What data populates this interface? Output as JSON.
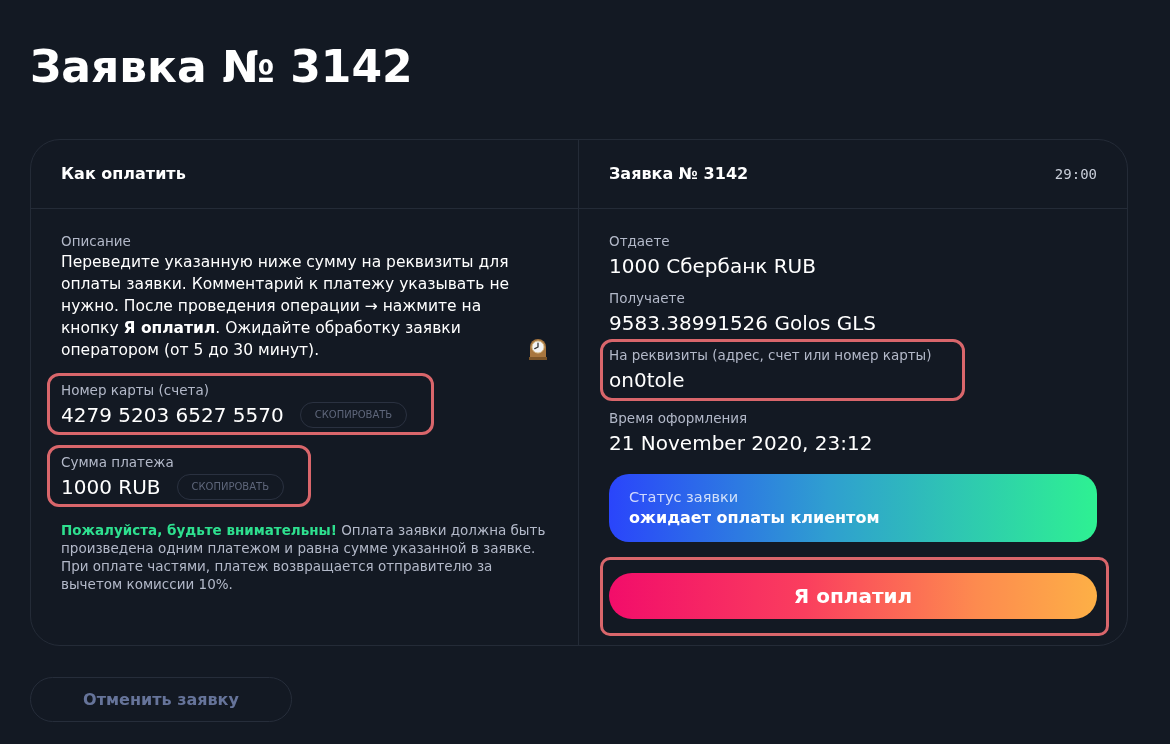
{
  "page": {
    "title": "Заявка № 3142"
  },
  "left_panel": {
    "title": "Как оплатить",
    "description": {
      "label": "Описание",
      "text": "Переведите указанную ниже сумму на реквизиты для оплаты заявки. Комментарий к платежу указывать не нужно. После проведения операции → нажмите на кнопку **Я оплатил**. Ожидайте обработку заявки оператором (от 5 до 30 минут)."
    },
    "fields": [
      {
        "label": "Номер карты (счета)",
        "value": "4279 5203 6527 5570",
        "copy_label": "СКОПИРОВАТЬ",
        "highlighted": true
      },
      {
        "label": "Сумма платежа",
        "value": "1000 RUB",
        "copy_label": "СКОПИРОВАТЬ",
        "highlighted": true
      }
    ],
    "warning": "**Пожалуйста, будьте внимательны!** Оплата заявки должна быть произведена одним платежом и равна сумме указанной в заявке. При оплате частями, платеж возвращается отправителю за вычетом комиссии 10%."
  },
  "right_panel": {
    "title": "Заявка № 3142",
    "timer": "29:00",
    "details": [
      {
        "label": "Отдаете",
        "value": "1000 Сбербанк RUB",
        "highlighted": false
      },
      {
        "label": "Получаете",
        "value": "9583.38991526 Golos GLS",
        "highlighted": false
      },
      {
        "label": "На реквизиты (адрес, счет или номер карты)",
        "value": "on0tole",
        "highlighted": true
      },
      {
        "label": "Время оформления",
        "value": "21 November 2020, 23:12",
        "highlighted": false
      }
    ],
    "status": {
      "label": "Статус заявки",
      "value": "ожидает оплаты клиентом"
    },
    "pay_button": {
      "label": "Я оплатил",
      "highlighted": true
    }
  },
  "cancel_button": {
    "label": "Отменить заявку"
  }
}
